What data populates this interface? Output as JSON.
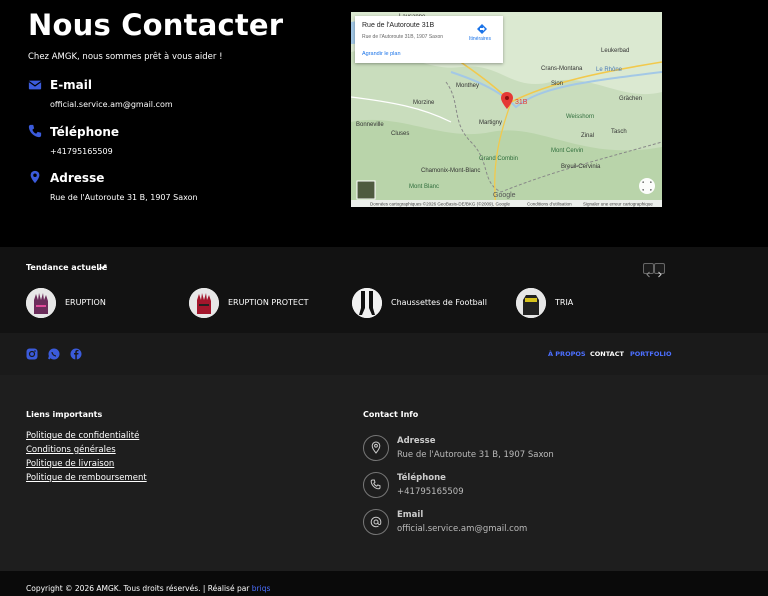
{
  "contact": {
    "title": "Nous Contacter",
    "intro": "Chez AMGK, nous sommes prêt à vous aider !",
    "email_title": "E-mail",
    "email_value": "official.service.am@gmail.com",
    "phone_title": "Téléphone",
    "phone_value": "+41795165509",
    "address_title": "Adresse",
    "address_value": "Rue de l'Autoroute 31 B, 1907 Saxon",
    "accent": "#3b5bdb"
  },
  "map": {
    "card_title": "Rue de l'Autoroute 31B",
    "card_address": "Rue de l'Autoroute 31B, 1907 Saxon",
    "directions_label": "Itinéraires",
    "enlarge_label": "Agrandir le plan",
    "marker_label": "31B",
    "place_labels": [
      "Lausanne",
      "Leukerbad",
      "Crans-Montana",
      "Le Rhône",
      "Monthey",
      "Sion",
      "Grächen",
      "Morzine",
      "Martigny",
      "Weisshorn",
      "Zinal",
      "Tasch",
      "Bonneville",
      "Cluses",
      "Grand Combin",
      "Mont Cervin",
      "Chamonix-Mont-Blanc",
      "Breuil-Cervinia",
      "Mont Blanc",
      "Google"
    ],
    "footer_text": "Données cartographiques ©2026 GeoBasis-DE/BKG (©2009), Google",
    "terms": "Conditions d'utilisation",
    "report": "Signaler une erreur cartographique"
  },
  "trending": {
    "label": "Tendance actuelle",
    "items": [
      {
        "name": "ERUPTION"
      },
      {
        "name": "ERUPTION PROTECT"
      },
      {
        "name": "Chaussettes de Football"
      },
      {
        "name": "TRIA"
      }
    ]
  },
  "navbar": {
    "links": [
      {
        "label": "À PROPOS",
        "color": "#4c6fff"
      },
      {
        "label": "CONTACT",
        "color": "#ffffff"
      },
      {
        "label": "PORTFOLIO",
        "color": "#4c6fff"
      }
    ],
    "social_icons": [
      "instagram-icon",
      "whatsapp-icon",
      "facebook-icon"
    ]
  },
  "footer": {
    "links_heading": "Liens importants",
    "links": [
      "Politique de confidentialité",
      "Conditions générales",
      "Politique de livraison",
      "Politique de remboursement"
    ],
    "contact_heading": "Contact Info",
    "contact": [
      {
        "title": "Adresse",
        "value": "Rue de l'Autoroute 31 B, 1907 Saxon",
        "icon": "location-icon"
      },
      {
        "title": "Téléphone",
        "value": "+41795165509",
        "icon": "phone-icon"
      },
      {
        "title": "Email",
        "value": "official.service.am@gmail.com",
        "icon": "at-icon"
      }
    ],
    "copyright": "Copyright © 2026  AMGK. Tous droits réservés. | Réalisé par ",
    "credit": "briqs"
  }
}
